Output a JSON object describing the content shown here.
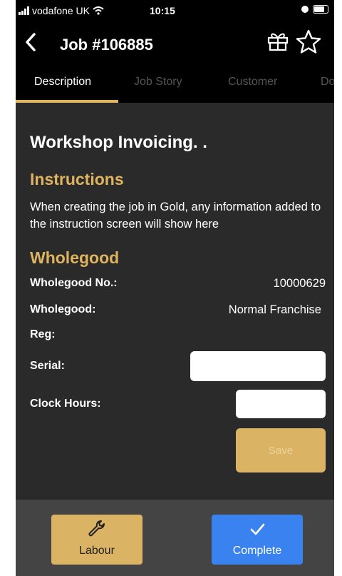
{
  "status_bar": {
    "carrier": "vodafone UK",
    "time": "10:15"
  },
  "header": {
    "title": "Job #106885",
    "icons": [
      "back-chevron-icon",
      "gift-icon",
      "star-icon"
    ]
  },
  "tabs": [
    {
      "label": "Description",
      "active": true
    },
    {
      "label": "Job Story",
      "active": false
    },
    {
      "label": "Customer",
      "active": false
    },
    {
      "label": "Doc",
      "active": false
    }
  ],
  "content": {
    "job_heading": "Workshop Invoicing. .",
    "instructions_title": "Instructions",
    "instructions_text": "When creating the job in Gold, any information added to the instruction screen will show here",
    "wholegood_title": "Wholegood",
    "rows": {
      "wholegood_no_label": "Wholegood No.:",
      "wholegood_no_value": "10000629",
      "wholegood_label": "Wholegood:",
      "wholegood_value": "Normal Franchise",
      "reg_label": "Reg:",
      "serial_label": "Serial:",
      "serial_value": "",
      "clock_hours_label": "Clock Hours:",
      "clock_hours_value": ""
    },
    "save_label": "Save"
  },
  "bottom_bar": {
    "labour_label": "Labour",
    "complete_label": "Complete"
  },
  "colors": {
    "accent_gold": "#e0b45f",
    "complete_blue": "#3a82f0",
    "background": "#2a2a2a"
  }
}
